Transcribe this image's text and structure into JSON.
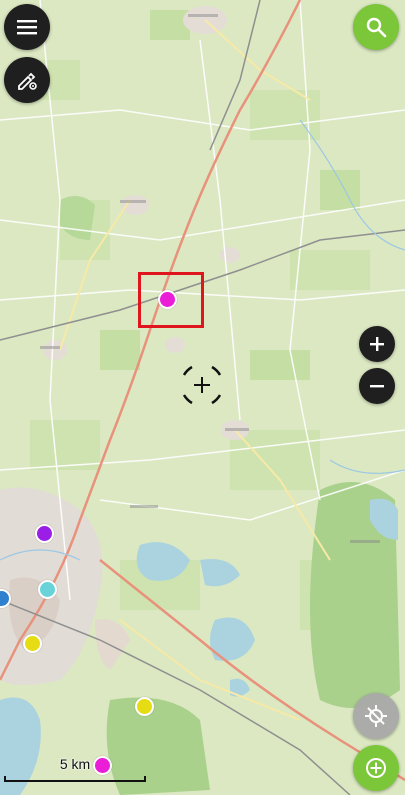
{
  "toolbar": {
    "menu_icon": "hamburger-menu-icon",
    "edit_icon": "pen-gear-icon",
    "search_icon": "search-icon",
    "zoom_in_icon": "plus-icon",
    "zoom_out_icon": "minus-icon",
    "location_icon": "location-disabled-icon",
    "add_icon": "add-circle-icon"
  },
  "scale_bar": {
    "label": "5 km"
  },
  "colors": {
    "accent_green": "#7cc63a",
    "button_dark": "#1f1f1f",
    "highlight_red": "#e0161e",
    "poi_magenta": "#e91ed6",
    "poi_purple": "#9a1ee6",
    "poi_cyan": "#6ad3da",
    "poi_blue": "#2f80cf",
    "poi_yellow": "#e6dc14"
  }
}
